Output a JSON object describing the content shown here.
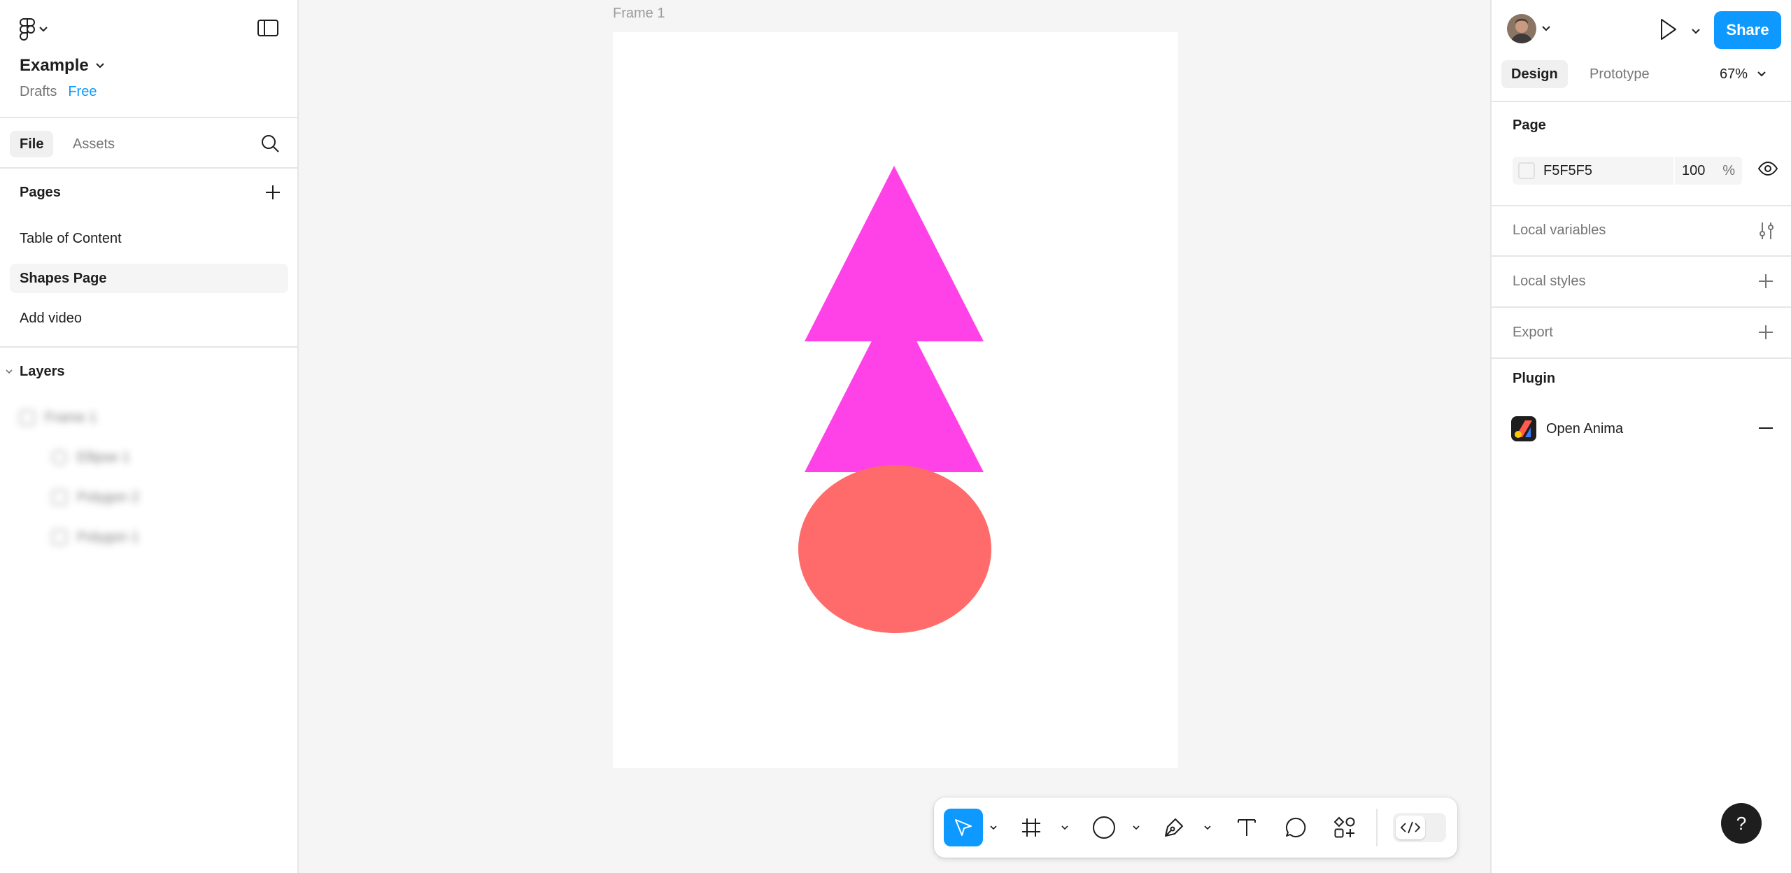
{
  "file": {
    "name": "Example",
    "location": "Drafts",
    "plan": "Free"
  },
  "left_tabs": {
    "file": "File",
    "assets": "Assets"
  },
  "pages": {
    "header": "Pages",
    "items": [
      {
        "label": "Table of Content",
        "selected": false
      },
      {
        "label": "Shapes Page",
        "selected": true
      },
      {
        "label": "Add video",
        "selected": false
      }
    ]
  },
  "layers": {
    "header": "Layers",
    "items": [
      "Frame 1",
      "Ellipse 1",
      "Polygon 2",
      "Polygon 1"
    ]
  },
  "canvas": {
    "frame_label": "Frame 1",
    "shapes": [
      {
        "type": "triangle",
        "color": "#FF42E8"
      },
      {
        "type": "triangle",
        "color": "#FF42E8"
      },
      {
        "type": "ellipse",
        "color": "#FF6B6B"
      }
    ]
  },
  "toolbar": {
    "tools": [
      "move-tool",
      "frame-tool",
      "shape-tool",
      "pen-tool",
      "text-tool",
      "comment-tool",
      "actions-tool"
    ],
    "dev_mode_icon": "code-icon"
  },
  "right_panel": {
    "share_label": "Share",
    "tabs": {
      "design": "Design",
      "prototype": "Prototype"
    },
    "zoom": "67%",
    "page_section": {
      "title": "Page",
      "background_hex": "F5F5F5",
      "opacity": "100",
      "opacity_unit": "%"
    },
    "local_variables": "Local variables",
    "local_styles": "Local styles",
    "export": "Export",
    "plugin_section": {
      "title": "Plugin",
      "name": "Open Anima"
    },
    "help": "?"
  },
  "colors": {
    "accent": "#0D99FF",
    "triangle": "#FF42E8",
    "ellipse": "#FF6B6B",
    "canvas_bg": "#F5F5F5"
  }
}
